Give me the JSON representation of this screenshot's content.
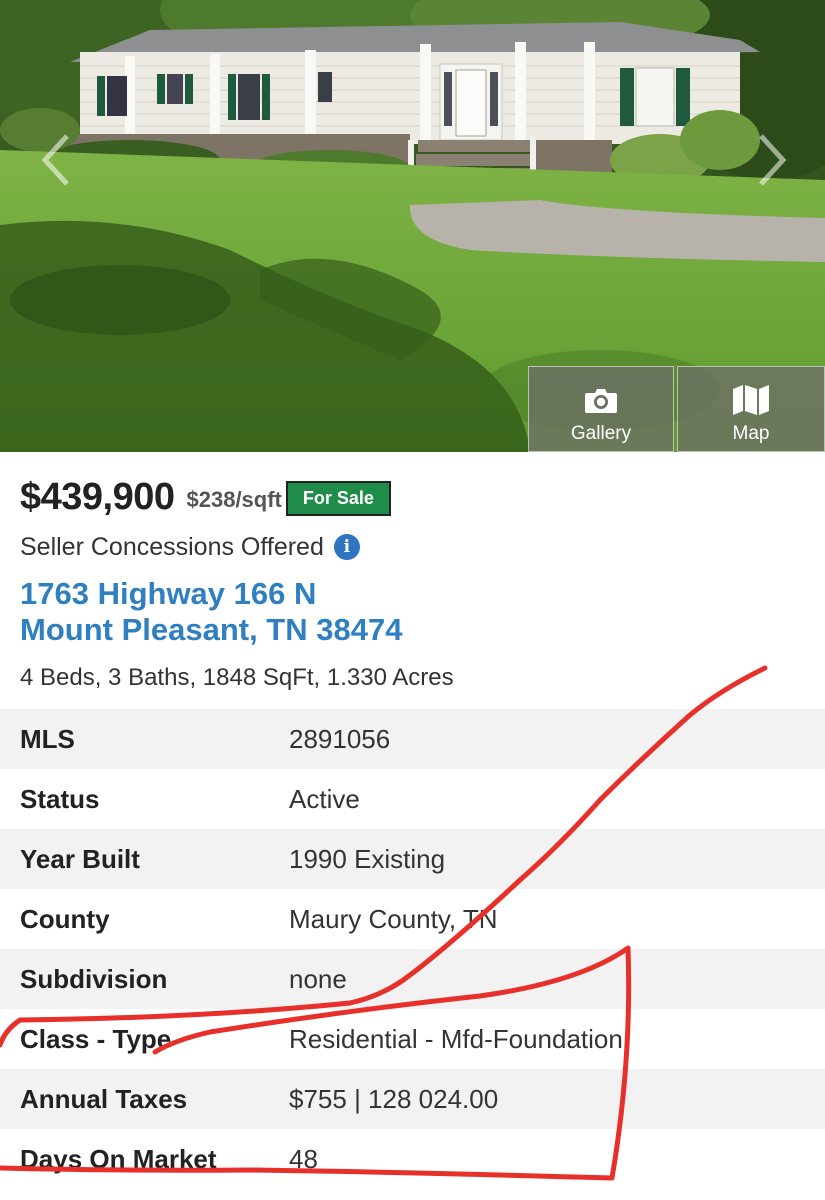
{
  "media": {
    "gallery_label": "Gallery",
    "map_label": "Map"
  },
  "listing": {
    "price": "$439,900",
    "price_per_sqft": "$238/sqft",
    "status_badge": "For Sale",
    "concessions": "Seller Concessions Offered",
    "address_line1": "1763 Highway 166 N",
    "address_line2": "Mount Pleasant, TN 38474",
    "summary": "4 Beds, 3 Baths, 1848 SqFt, 1.330 Acres"
  },
  "details": [
    {
      "label": "MLS",
      "value": "2891056"
    },
    {
      "label": "Status",
      "value": "Active"
    },
    {
      "label": "Year Built",
      "value": "1990 Existing"
    },
    {
      "label": "County",
      "value": "Maury County, TN"
    },
    {
      "label": "Subdivision",
      "value": "none"
    },
    {
      "label": "Class - Type",
      "value": "Residential - Mfd-Foundation"
    },
    {
      "label": "Annual Taxes",
      "value": "$755 | 128 024.00"
    },
    {
      "label": "Days On Market",
      "value": "48"
    }
  ],
  "colors": {
    "link_blue": "#2f7fc1",
    "badge_green": "#1f8c4a",
    "annotation_red": "#e8302a",
    "info_blue": "#2f74c0"
  },
  "icons": [
    "chevron-left-icon",
    "chevron-right-icon",
    "camera-icon",
    "map-icon",
    "info-icon"
  ]
}
